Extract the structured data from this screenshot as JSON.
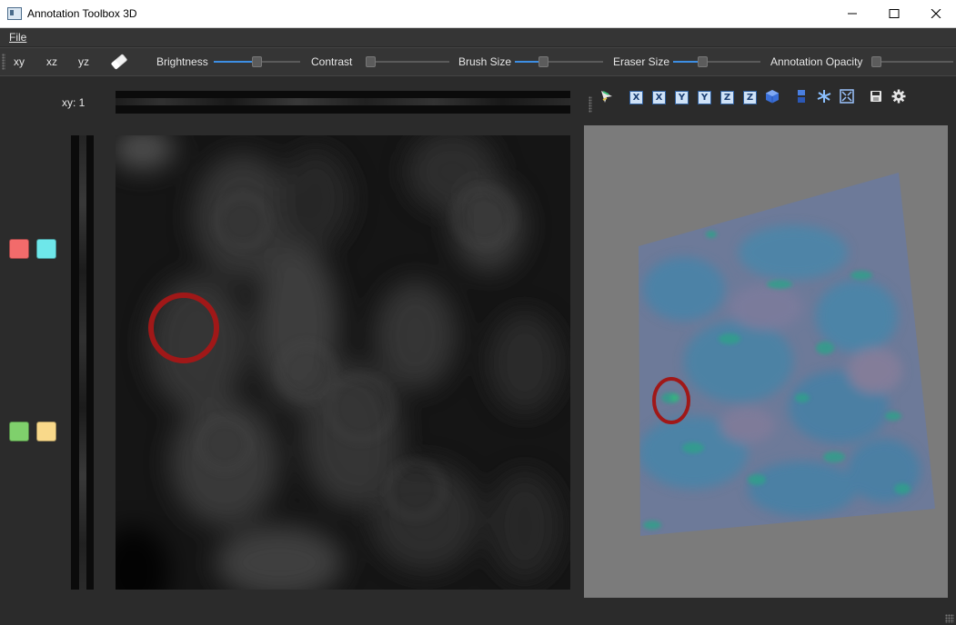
{
  "window": {
    "title": "Annotation Toolbox 3D"
  },
  "menu": {
    "file_label": "File"
  },
  "toolbar": {
    "view_buttons": [
      "xy",
      "xz",
      "yz"
    ],
    "eraser_icon": "eraser-icon",
    "brightness_label": "Brightness",
    "brightness_value": 0.48,
    "contrast_label": "Contrast",
    "contrast_value": 0.0,
    "brush_size_label": "Brush Size",
    "brush_size_value": 0.31,
    "eraser_size_label": "Eraser Size",
    "eraser_size_value": 0.32,
    "opacity_label": "Annotation Opacity",
    "opacity_value": 0.0
  },
  "viewer": {
    "slice_label": "xy: 1",
    "annotation_colors": [
      "#f26b6b",
      "#6ee7ea",
      "#7fd06c",
      "#f9d98a"
    ]
  },
  "view3d": {
    "toolbar_icons": [
      "pointer-icon",
      "x-axis-icon",
      "x-axis-reverse-icon",
      "y-axis-icon",
      "y-axis-reverse-icon",
      "z-axis-icon",
      "z-axis-reverse-icon",
      "cube-icon",
      "layers-icon",
      "axes-icon",
      "fit-view-icon",
      "screenshot-icon",
      "settings-icon"
    ],
    "axis_labels": [
      "X",
      "X",
      "Y",
      "Y",
      "Z",
      "Z"
    ]
  },
  "colors": {
    "accent": "#3d8ee3",
    "annotation": "#a01818"
  }
}
